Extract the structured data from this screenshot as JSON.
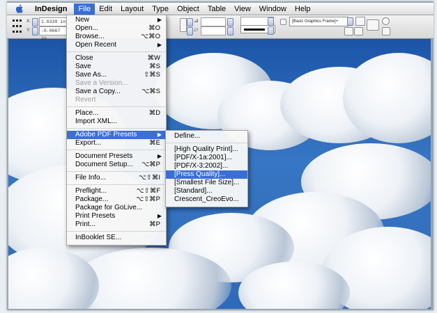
{
  "menubar": {
    "app": "InDesign",
    "items": [
      "File",
      "Edit",
      "Layout",
      "Type",
      "Object",
      "Table",
      "View",
      "Window",
      "Help"
    ]
  },
  "control": {
    "x_label": "X:",
    "x_value": "1.6339 in",
    "y_label": "Y:",
    "y_value": "-0.0667 in",
    "frame_style": "[Basic Graphics Frame]+"
  },
  "file_menu": {
    "items": [
      {
        "label": "New",
        "shortcut": "",
        "submenu": true,
        "disabled": false
      },
      {
        "label": "Open...",
        "shortcut": "⌘O",
        "submenu": false,
        "disabled": false
      },
      {
        "label": "Browse...",
        "shortcut": "⌥⌘O",
        "submenu": false,
        "disabled": false
      },
      {
        "label": "Open Recent",
        "shortcut": "",
        "submenu": true,
        "disabled": false
      },
      {
        "sep": true
      },
      {
        "label": "Close",
        "shortcut": "⌘W",
        "submenu": false,
        "disabled": false
      },
      {
        "label": "Save",
        "shortcut": "⌘S",
        "submenu": false,
        "disabled": false
      },
      {
        "label": "Save As...",
        "shortcut": "⇧⌘S",
        "submenu": false,
        "disabled": false
      },
      {
        "label": "Save a Version...",
        "shortcut": "",
        "submenu": false,
        "disabled": true
      },
      {
        "label": "Save a Copy...",
        "shortcut": "⌥⌘S",
        "submenu": false,
        "disabled": false
      },
      {
        "label": "Revert",
        "shortcut": "",
        "submenu": false,
        "disabled": true
      },
      {
        "sep": true
      },
      {
        "label": "Place...",
        "shortcut": "⌘D",
        "submenu": false,
        "disabled": false
      },
      {
        "label": "Import XML...",
        "shortcut": "",
        "submenu": false,
        "disabled": false
      },
      {
        "sep": true
      },
      {
        "label": "Adobe PDF Presets",
        "shortcut": "",
        "submenu": true,
        "disabled": false,
        "highlighted": true
      },
      {
        "label": "Export...",
        "shortcut": "⌘E",
        "submenu": false,
        "disabled": false
      },
      {
        "sep": true
      },
      {
        "label": "Document Presets",
        "shortcut": "",
        "submenu": true,
        "disabled": false
      },
      {
        "label": "Document Setup...",
        "shortcut": "⌥⌘P",
        "submenu": false,
        "disabled": false
      },
      {
        "sep": true
      },
      {
        "label": "File Info...",
        "shortcut": "⌥⇧⌘I",
        "submenu": false,
        "disabled": false
      },
      {
        "sep": true
      },
      {
        "label": "Preflight...",
        "shortcut": "⌥⇧⌘F",
        "submenu": false,
        "disabled": false
      },
      {
        "label": "Package...",
        "shortcut": "⌥⇧⌘P",
        "submenu": false,
        "disabled": false
      },
      {
        "label": "Package for GoLive...",
        "shortcut": "",
        "submenu": false,
        "disabled": false
      },
      {
        "label": "Print Presets",
        "shortcut": "",
        "submenu": true,
        "disabled": false
      },
      {
        "label": "Print...",
        "shortcut": "⌘P",
        "submenu": false,
        "disabled": false
      },
      {
        "sep": true
      },
      {
        "label": "InBooklet SE...",
        "shortcut": "",
        "submenu": false,
        "disabled": false
      }
    ]
  },
  "pdf_submenu": {
    "items": [
      {
        "label": "Define..."
      },
      {
        "sep": true
      },
      {
        "label": "[High Quality Print]..."
      },
      {
        "label": "[PDF/X-1a:2001]..."
      },
      {
        "label": "[PDF/X-3:2002]..."
      },
      {
        "label": "[Press Quality]...",
        "highlighted": true
      },
      {
        "label": "[Smallest File Size]..."
      },
      {
        "label": "[Standard]..."
      },
      {
        "label": "Crescent_CreoEvo..."
      }
    ]
  }
}
